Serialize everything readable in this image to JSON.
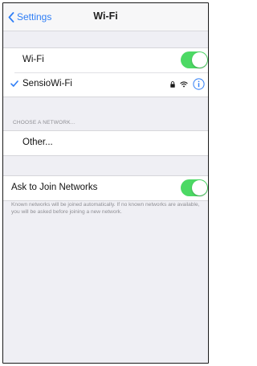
{
  "nav": {
    "back_label": "Settings",
    "title": "Wi-Fi"
  },
  "wifi_group": {
    "toggle_label": "Wi-Fi",
    "toggle_on": true,
    "connected_network": "SensioWi-Fi"
  },
  "choose_network": {
    "header": "CHOOSE A NETWORK...",
    "other_label": "Other..."
  },
  "ask_to_join": {
    "label": "Ask to Join Networks",
    "toggle_on": true,
    "description": "Known networks will be joined automatically. If no known networks are available, you will be asked before joining a new network."
  },
  "colors": {
    "accent": "#2f7ef6",
    "toggle_on": "#4cd964",
    "background": "#efeff4"
  },
  "icons": {
    "back": "chevron-left-icon",
    "check": "checkmark-icon",
    "lock": "lock-icon",
    "wifi": "wifi-signal-icon",
    "info": "info-icon"
  }
}
